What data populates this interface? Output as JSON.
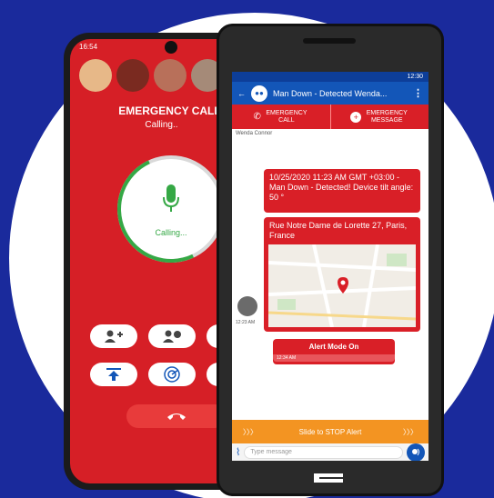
{
  "left_phone": {
    "status_time": "16:54",
    "title": "EMERGENCY CALL",
    "subtitle": "Calling..",
    "ring_label": "Calling...",
    "buttons": [
      "add-contact-icon",
      "contact-info-icon",
      "upload-icon",
      "radar-icon"
    ],
    "end_call_icon": "phone-hangup-icon"
  },
  "right_phone": {
    "status_time": "12:30",
    "app_title": "Man Down - Detected Wenda...",
    "actions": {
      "call": "EMERGENCY CALL",
      "message": "EMERGENCY MESSAGE"
    },
    "sender_name": "Wenda Connor",
    "message_1": "10/25/2020 11:23 AM GMT +03:00 - Man Down - Detected! Device tilt angle: 50 °",
    "message_2_address": "Rue Notre Dame de Lorette 27, Paris, France",
    "message_time": "12:23 AM",
    "alert_title": "Alert Mode On",
    "alert_time": "12:34 AM",
    "slide_text": "Slide to STOP Alert",
    "compose_placeholder": "Type message"
  },
  "colors": {
    "background": "#1a2a9c",
    "emergency_red": "#d61f26",
    "app_blue": "#1356b8",
    "accent_orange": "#f39422",
    "call_green": "#35a845"
  }
}
